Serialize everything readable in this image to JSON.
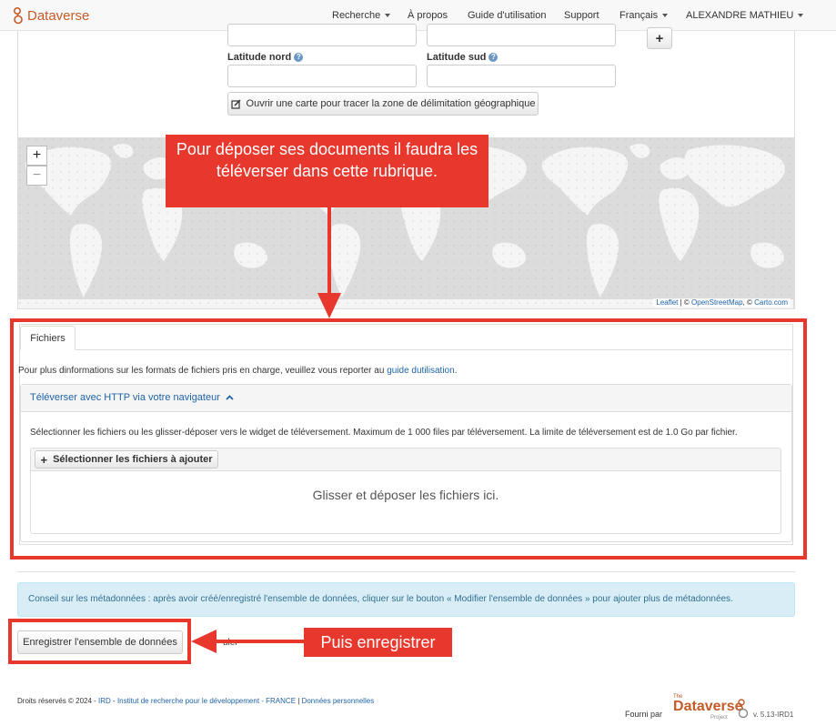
{
  "navbar": {
    "brand": "Dataverse",
    "items": [
      {
        "label": "Recherche",
        "dropdown": true
      },
      {
        "label": "À propos",
        "dropdown": false
      },
      {
        "label": "Guide d'utilisation",
        "dropdown": false
      },
      {
        "label": "Support",
        "dropdown": false
      },
      {
        "label": "Français",
        "dropdown": true
      },
      {
        "label": "ALEXANDRE MATHIEU",
        "dropdown": true
      }
    ]
  },
  "geo": {
    "add_button": "+",
    "north_label": "Latitude nord",
    "south_label": "Latitude sud",
    "map_button": "Ouvrir une carte pour tracer la zone de délimitation géographique"
  },
  "map": {
    "zoom_in": "+",
    "zoom_out": "−",
    "attribution": {
      "leaflet": "Leaflet",
      "sep1": " | © ",
      "osm": "OpenStreetMap",
      "sep2": ", © ",
      "carto": "Carto.com"
    }
  },
  "annotations": {
    "callout_files": "Pour déposer ses documents il faudra les téléverser dans cette rubrique.",
    "callout_save": "Puis enregistrer"
  },
  "files": {
    "tab_label": "Fichiers",
    "formats_text": "Pour plus dinformations sur les formats de fichiers pris en charge, veuillez vous reporter au ",
    "formats_link": "guide dutilisation",
    "formats_end": ".",
    "upload_title": "Téléverser avec HTTP via votre navigateur",
    "upload_description": "Sélectionner les fichiers ou les glisser-déposer vers le widget de téléversement. Maximum de 1 000 files par téléversement. La limite de téléversement est de 1.0 Go par fichier.",
    "select_button": "Sélectionner les fichiers à ajouter",
    "drop_text": "Glisser et déposer les fichiers ici."
  },
  "tip": "Conseil sur les métadonnées : après avoir créé/enregistré l'ensemble de données, cliquer sur le bouton « Modifier l'ensemble de données » pour ajouter plus de métadonnées.",
  "save_button": "Enregistrer l'ensemble de données",
  "partially_hidden_text": "uler",
  "footer": {
    "copyright": "Droits réservés © 2024 - ",
    "ird": "IRD",
    "sep": " - ",
    "institute": "Institut de recherche pour le développement - FRANCE",
    "pipe": " | ",
    "privacy": "Données personnelles",
    "powered_by": "Fourni par",
    "logo_the": "The",
    "logo_word": "Dataverse",
    "logo_project": "Project",
    "version": "v. 5.13-IRD1"
  },
  "colors": {
    "brand": "#c55b28",
    "link": "#1f63a8",
    "annotation_red": "#e8382d",
    "tip_bg": "#d9edf7",
    "tip_text": "#31708f",
    "map_land": "#f5f5f5",
    "map_water": "#dcdcdc"
  }
}
